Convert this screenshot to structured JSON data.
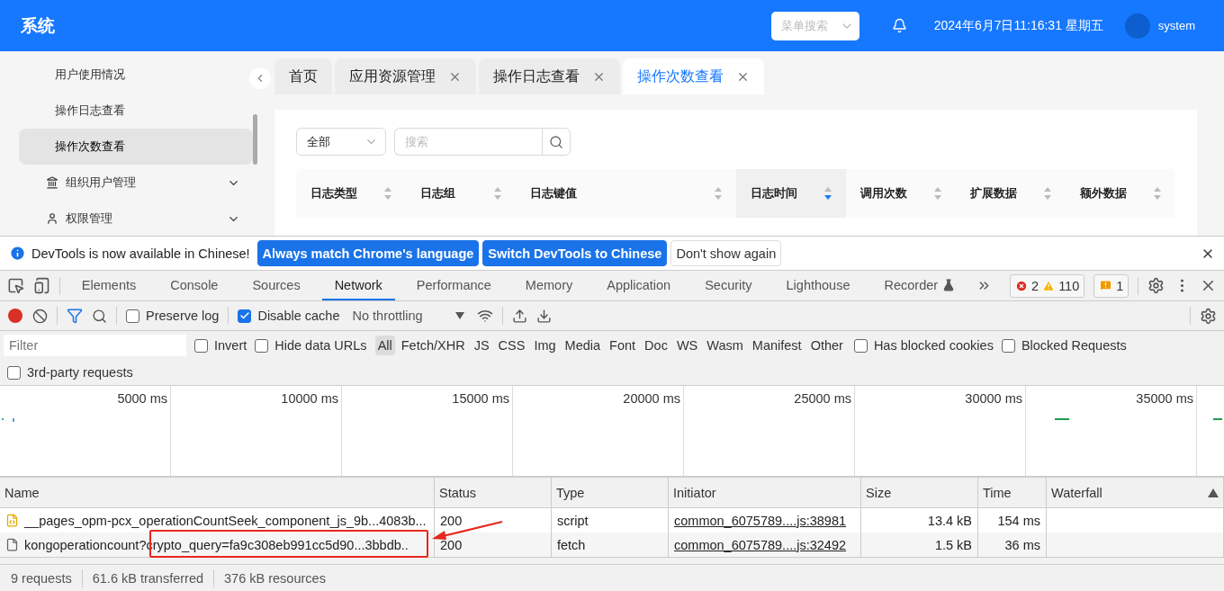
{
  "header": {
    "title": "系统",
    "menu_search": {
      "placeholder": "菜单搜索"
    },
    "datetime": "2024年6月7日11:16:31 星期五",
    "user": "system"
  },
  "sidebar": {
    "items": [
      {
        "label": "用户使用情况",
        "selected": false,
        "kind": "leaf"
      },
      {
        "label": "操作日志查看",
        "selected": false,
        "kind": "leaf"
      },
      {
        "label": "操作次数查看",
        "selected": true,
        "kind": "leaf"
      },
      {
        "label": "组织用户管理",
        "selected": false,
        "kind": "group"
      },
      {
        "label": "权限管理",
        "selected": false,
        "kind": "group"
      }
    ]
  },
  "tabs": [
    {
      "label": "首页",
      "selected": false,
      "closable": false
    },
    {
      "label": "应用资源管理",
      "selected": false,
      "closable": true
    },
    {
      "label": "操作日志查看",
      "selected": false,
      "closable": true
    },
    {
      "label": "操作次数查看",
      "selected": true,
      "closable": true
    }
  ],
  "filter": {
    "select": "全部",
    "search": {
      "placeholder": "搜索"
    }
  },
  "table": {
    "columns": [
      {
        "label": "日志类型",
        "sorted": false
      },
      {
        "label": "日志组",
        "sorted": false
      },
      {
        "label": "日志键值",
        "sorted": false
      },
      {
        "label": "日志时间",
        "sorted": true
      },
      {
        "label": "调用次数",
        "sorted": false
      },
      {
        "label": "扩展数据",
        "sorted": false
      },
      {
        "label": "额外数据",
        "sorted": false
      }
    ]
  },
  "devtools": {
    "infobar": {
      "message": "DevTools is now available in Chinese!",
      "buttons": [
        {
          "label": "Always match Chrome's language",
          "kind": "primary"
        },
        {
          "label": "Switch DevTools to Chinese",
          "kind": "primary"
        },
        {
          "label": "Don't show again",
          "kind": "secondary"
        }
      ]
    },
    "panels": [
      {
        "label": "Elements",
        "selected": false
      },
      {
        "label": "Console",
        "selected": false
      },
      {
        "label": "Sources",
        "selected": false
      },
      {
        "label": "Network",
        "selected": true
      },
      {
        "label": "Performance",
        "selected": false
      },
      {
        "label": "Memory",
        "selected": false
      },
      {
        "label": "Application",
        "selected": false
      },
      {
        "label": "Security",
        "selected": false
      },
      {
        "label": "Lighthouse",
        "selected": false
      },
      {
        "label": "Recorder",
        "selected": false
      }
    ],
    "errors": "2",
    "warnings": "110",
    "issues": "1",
    "toolbar": {
      "recording": true,
      "filter_active": true,
      "preserve_log": {
        "label": "Preserve log",
        "checked": false
      },
      "disable_cache": {
        "label": "Disable cache",
        "checked": true
      },
      "throttling": "No throttling"
    },
    "filter_bar": {
      "placeholder": "Filter",
      "invert": {
        "label": "Invert",
        "checked": false
      },
      "hide_data_urls": {
        "label": "Hide data URLs",
        "checked": false
      },
      "types": [
        {
          "label": "All",
          "selected": true
        },
        {
          "label": "Fetch/XHR",
          "selected": false
        },
        {
          "label": "JS",
          "selected": false
        },
        {
          "label": "CSS",
          "selected": false
        },
        {
          "label": "Img",
          "selected": false
        },
        {
          "label": "Media",
          "selected": false
        },
        {
          "label": "Font",
          "selected": false
        },
        {
          "label": "Doc",
          "selected": false
        },
        {
          "label": "WS",
          "selected": false
        },
        {
          "label": "Wasm",
          "selected": false
        },
        {
          "label": "Manifest",
          "selected": false
        },
        {
          "label": "Other",
          "selected": false
        }
      ],
      "blocked_cookies": {
        "label": "Has blocked cookies",
        "checked": false
      },
      "blocked_requests": {
        "label": "Blocked Requests",
        "checked": false
      },
      "third_party": {
        "label": "3rd-party requests",
        "checked": false
      }
    },
    "overview_ticks": [
      "5000 ms",
      "10000 ms",
      "15000 ms",
      "20000 ms",
      "25000 ms",
      "30000 ms",
      "35000 ms"
    ],
    "columns": [
      "Name",
      "Status",
      "Type",
      "Initiator",
      "Size",
      "Time",
      "Waterfall"
    ],
    "requests": [
      {
        "kind": "script",
        "name": "__pages_opm-pcx_operationCountSeek_component_js_9b...4083b...",
        "status": "200",
        "type": "script",
        "initiator": "common_6075789....js:38981",
        "size": "13.4 kB",
        "time": "154 ms",
        "highlighted": false
      },
      {
        "kind": "fetch",
        "name": "kongoperationcount?crypto_query=fa9c308eb991cc5d90...3bbdb..",
        "status": "200",
        "type": "fetch",
        "initiator": "common_6075789....js:32492",
        "size": "1.5 kB",
        "time": "36 ms",
        "highlighted": true
      }
    ],
    "status": [
      "9 requests",
      "61.6 kB transferred",
      "376 kB resources"
    ]
  }
}
